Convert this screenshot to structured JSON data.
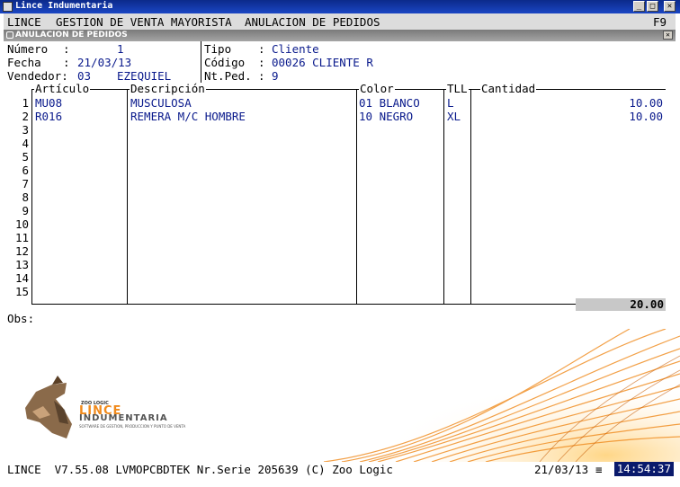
{
  "window": {
    "title": "Lince Indumentaria"
  },
  "menu": {
    "app": "LINCE",
    "module": "GESTION DE VENTA MAYORISTA",
    "screen": "ANULACION DE PEDIDOS",
    "key": "F9"
  },
  "form": {
    "title": "ANULACION DE PEDIDOS",
    "numero_label": "Número",
    "numero_sep": ":",
    "numero_value": "1",
    "fecha_label": "Fecha",
    "fecha_sep": ":",
    "fecha_value": "21/03/13",
    "vendedor_label": "Vendedor:",
    "vendedor_code": "03",
    "vendedor_name": "EZEQUIEL",
    "tipo_label": "Tipo",
    "tipo_sep": ":",
    "tipo_value": "Cliente",
    "codigo_label": "Código",
    "codigo_sep": ":",
    "codigo_value": "00026 CLIENTE R",
    "ntped_label": "Nt.Ped.",
    "ntped_sep": ":",
    "ntped_value": "9"
  },
  "grid": {
    "columns": {
      "articulo": "Artículo",
      "descripcion": "Descripción",
      "color": "Color",
      "tll": "TLL",
      "cantidad": "Cantidad"
    },
    "row_numbers": [
      "1",
      "2",
      "3",
      "4",
      "5",
      "6",
      "7",
      "8",
      "9",
      "10",
      "11",
      "12",
      "13",
      "14",
      "15"
    ],
    "rows": [
      {
        "articulo": "MU08",
        "descripcion": "MUSCULOSA",
        "color": "01 BLANCO",
        "tll": "L",
        "cantidad": "10.00"
      },
      {
        "articulo": "R016",
        "descripcion": "REMERA M/C HOMBRE",
        "color": "10 NEGRO",
        "tll": "XL",
        "cantidad": "10.00"
      }
    ],
    "total": "20.00"
  },
  "obs_label": "Obs:",
  "brand": {
    "company": "ZOO LOGIC",
    "line1": "LINCE",
    "line2": "INDUMENTARIA",
    "tagline": "SOFTWARE DE GESTION, PRODUCCION Y PUNTO DE VENTA"
  },
  "status": {
    "info": "LINCE  V7.55.08 LVMOPCBDTEK Nr.Serie 205639 (C) Zoo Logic",
    "date": "21/03/13",
    "menu_glyph": "≡",
    "time": "14:54:37"
  },
  "colors": {
    "value_text": "#0a1a8c",
    "title_bar": "#1a46c4",
    "clock_bg": "#0a1a6c",
    "brand_orange": "#f08a1c"
  }
}
